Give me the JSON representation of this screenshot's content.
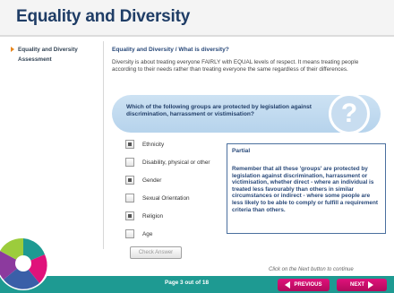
{
  "header": {
    "title": "Equality and Diversity"
  },
  "sidebar": {
    "items": [
      {
        "label": "Equality and Diversity",
        "active": true
      },
      {
        "label": "Assessment",
        "active": false
      }
    ]
  },
  "content": {
    "breadcrumb": "Equality and Diversity / What is diversity?",
    "intro": "Diversity is about treating everyone FAIRLY with EQUAL levels of respect. It means treating people according to their needs rather than treating everyone the same regardless of their differences."
  },
  "question": {
    "text": "Which of the following groups are protected by legislation against discrimination, harrassment or vistimisation?",
    "icon": "question-mark"
  },
  "options": [
    {
      "label": "Ethnicity",
      "checked": true
    },
    {
      "label": "Disability, physical or other",
      "checked": false
    },
    {
      "label": "Gender",
      "checked": true
    },
    {
      "label": "Sexual Orientation",
      "checked": false
    },
    {
      "label": "Religion",
      "checked": true
    },
    {
      "label": "Age",
      "checked": false
    }
  ],
  "check_button": {
    "label": "Check Answer"
  },
  "feedback": {
    "title": "Partial",
    "text": "Remember that all these 'groups' are protected by legislation against discrimination, harrassment or victimisation, whether direct - where an individual is treated less favourably than others in similar circumstances or indirect - where some people are less likely to be able to comply or fulfill a requirement criteria than others."
  },
  "footer": {
    "hint": "Click on the Next button to continue",
    "page_count": "Page 3 out of 18",
    "prev_label": "PREVIOUS",
    "next_label": "NEXT"
  },
  "colors": {
    "accent": "#1e9a92",
    "nav_button": "#d0106f",
    "title": "#1f3d66"
  }
}
